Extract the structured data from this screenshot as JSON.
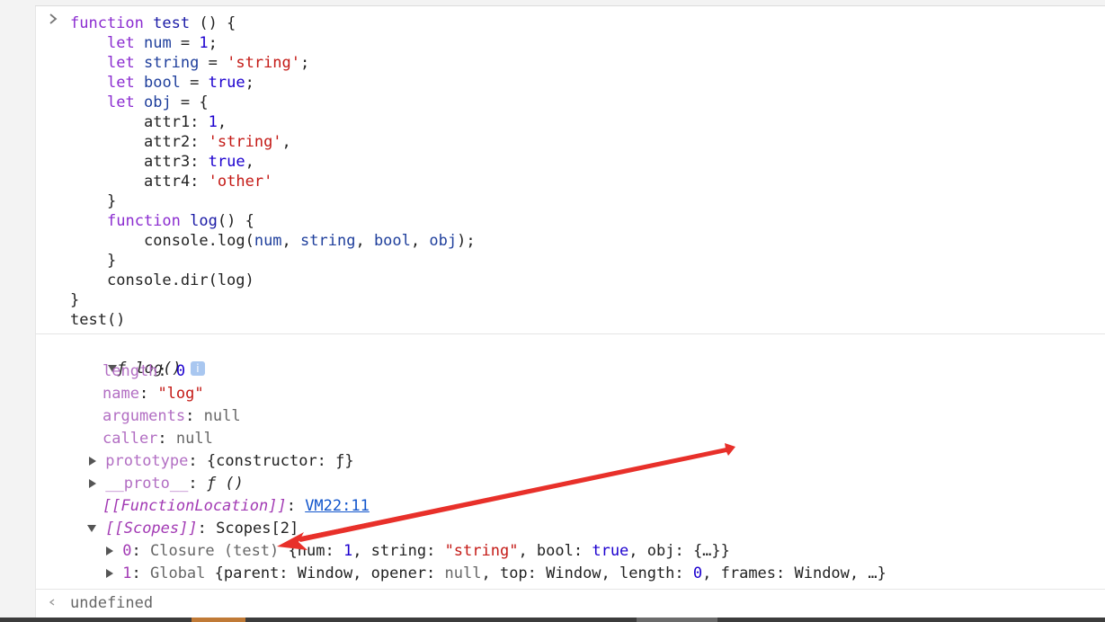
{
  "code": {
    "l1": {
      "kw": "function",
      "name": "test",
      "rest": " () {"
    },
    "l2": {
      "kw": "let",
      "id": "num",
      "eq": " = ",
      "val": "1",
      "end": ";"
    },
    "l3": {
      "kw": "let",
      "id": "string",
      "eq": " = ",
      "val": "'string'",
      "end": ";"
    },
    "l4": {
      "kw": "let",
      "id": "bool",
      "eq": " = ",
      "val": "true",
      "end": ";"
    },
    "l5": {
      "kw": "let",
      "id": "obj",
      "rest": " = {"
    },
    "l6": {
      "key": "attr1: ",
      "val": "1",
      "end": ","
    },
    "l7": {
      "key": "attr2: ",
      "val": "'string'",
      "end": ","
    },
    "l8": {
      "key": "attr3: ",
      "val": "true",
      "end": ","
    },
    "l9": {
      "key": "attr4: ",
      "val": "'other'"
    },
    "l10": "}",
    "l11": {
      "kw": "function",
      "name": "log",
      "rest": "() {"
    },
    "l12": {
      "pre": "console.log(",
      "a": "num",
      "c1": ", ",
      "b": "string",
      "c2": ", ",
      "c": "bool",
      "c3": ", ",
      "d": "obj",
      "end": ");"
    },
    "l13": "}",
    "l14": "console.dir(log)",
    "l15": "}",
    "l16": "test()"
  },
  "output": {
    "head": "ƒ log()",
    "info_glyph": "i",
    "length_key": "length",
    "length_val": "0",
    "name_key": "name",
    "name_val": "\"log\"",
    "arguments_key": "arguments",
    "arguments_val": "null",
    "caller_key": "caller",
    "caller_val": "null",
    "prototype_key": "prototype",
    "prototype_val": "{constructor: ƒ}",
    "proto_key": "__proto__",
    "proto_val": "ƒ ()",
    "fnloc_key": "[[FunctionLocation]]",
    "fnloc_val": "VM22:11",
    "scopes_key": "[[Scopes]]",
    "scopes_val": "Scopes[2]",
    "scope0": {
      "idx": "0",
      "label": "Closure (test)",
      "o1": "{num: ",
      "v1": "1",
      "o2": ", string: ",
      "v2": "\"string\"",
      "o3": ", bool: ",
      "v3": "true",
      "o4": ", obj: {…}}"
    },
    "scope1": {
      "idx": "1",
      "label": "Global",
      "o1": "{parent: Window, opener: ",
      "v1": "null",
      "o2": ", top: Window, length: ",
      "v2": "0",
      "o3": ", frames: Window, …}"
    },
    "colon": ": "
  },
  "result": {
    "value": "undefined"
  },
  "colors": {
    "arrow": "#e8302a",
    "keyword": "#8b2cd0",
    "string": "#c41a16",
    "number": "#1c00cf"
  },
  "icons": [
    "chevron-right-icon",
    "expand-triangle-icon",
    "info-icon",
    "return-arrow-icon",
    "red-annotation-arrow"
  ]
}
